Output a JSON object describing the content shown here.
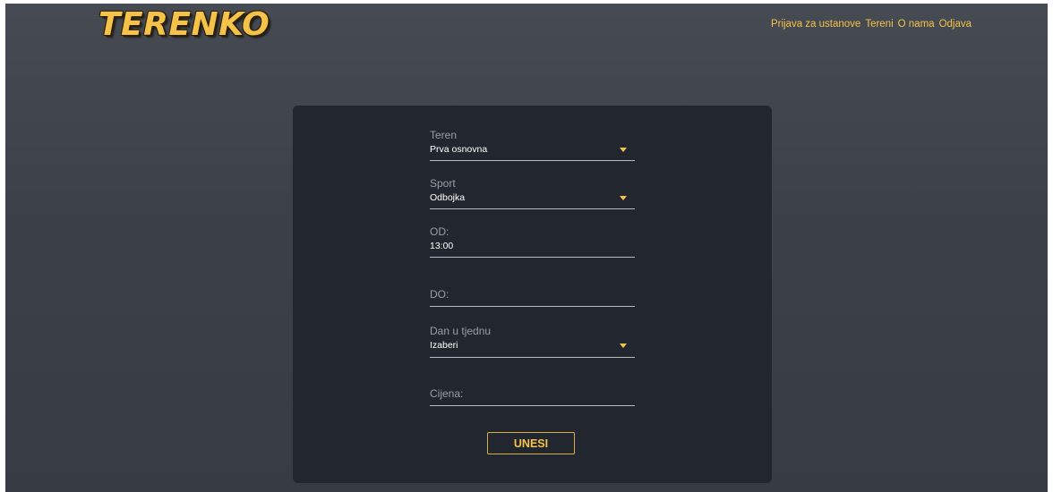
{
  "header": {
    "logo": "TERENKO",
    "nav": [
      {
        "label": "Prijava za ustanove"
      },
      {
        "label": "Tereni"
      },
      {
        "label": "O nama"
      },
      {
        "label": "Odjava"
      }
    ]
  },
  "form": {
    "teren": {
      "label": "Teren",
      "value": "Prva osnovna"
    },
    "sport": {
      "label": "Sport",
      "value": "Odbojka"
    },
    "od": {
      "label": "OD:",
      "value": "13:00"
    },
    "do": {
      "label": "DO:",
      "value": ""
    },
    "dan": {
      "label": "Dan u tjednu",
      "value": "Izaberi"
    },
    "cijena": {
      "label": "Cijena:",
      "value": ""
    },
    "submit_label": "UNESI"
  },
  "colors": {
    "accent": "#f5c34a",
    "background": "#3d4149",
    "card": "#22262e"
  },
  "icons": {
    "dropdown": "caret-down-icon"
  }
}
